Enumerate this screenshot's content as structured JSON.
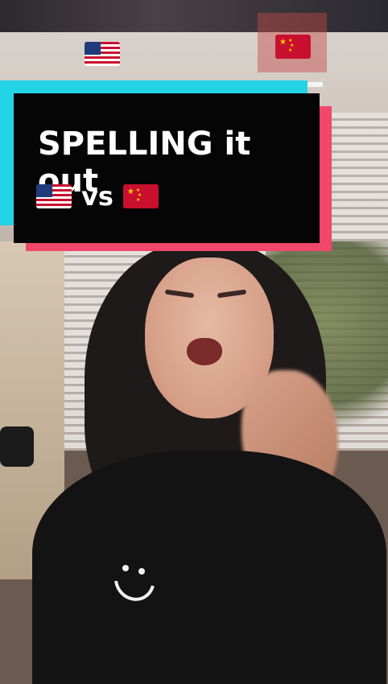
{
  "caption": {
    "title": "SPELLING it out",
    "middle_word": "vs",
    "left_flag": "us-flag-icon",
    "right_flag": "cn-flag-icon"
  },
  "overlay": {
    "top_left_flag": "us-flag-icon",
    "top_right_flag": "cn-flag-icon"
  },
  "colors": {
    "caption_bg": "#050505",
    "caption_cyan": "#23d3e6",
    "caption_pink": "#f0476a",
    "caption_text": "#ffffff"
  }
}
